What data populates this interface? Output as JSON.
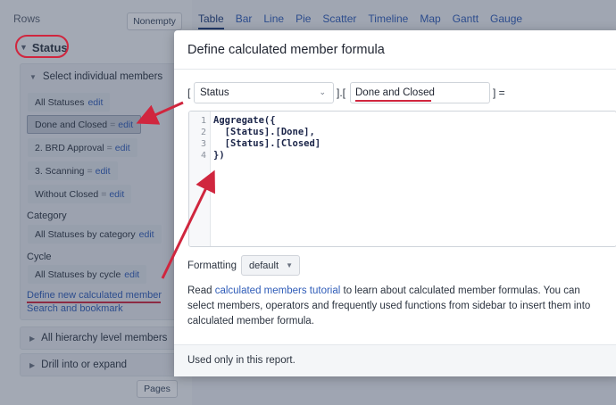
{
  "rows_panel": {
    "title": "Rows",
    "nonempty_label": "Nonempty",
    "dimension_label": "Status",
    "select_members_label": "Select individual members",
    "members": [
      {
        "name": "All Statuses",
        "eq": "",
        "edit": "edit"
      },
      {
        "name": "Done and Closed",
        "eq": "=",
        "edit": "edit"
      },
      {
        "name": "2. BRD Approval",
        "eq": "=",
        "edit": "edit"
      },
      {
        "name": "3. Scanning",
        "eq": "=",
        "edit": "edit"
      },
      {
        "name": "Without Closed",
        "eq": "=",
        "edit": "edit"
      }
    ],
    "category_label": "Category",
    "category_member": {
      "name": "All Statuses by category",
      "edit": "edit"
    },
    "cycle_label": "Cycle",
    "cycle_member": {
      "name": "All Statuses by cycle",
      "edit": "edit"
    },
    "define_link": "Define new calculated member",
    "search_link": "Search and bookmark",
    "hierarchy_label": "All hierarchy level members",
    "drill_label": "Drill into or expand",
    "pages_label": "Pages"
  },
  "tabs": [
    "Table",
    "Bar",
    "Line",
    "Pie",
    "Scatter",
    "Timeline",
    "Map",
    "Gantt",
    "Gauge"
  ],
  "modal": {
    "title": "Define calculated member formula",
    "bracket_open": "[",
    "bracket_mid": "].[",
    "bracket_close": "] =",
    "dimension_select": "Status",
    "member_name": "Done and Closed",
    "code_lines": [
      "Aggregate({",
      "  [Status].[Done],",
      "  [Status].[Closed]",
      "})"
    ],
    "line_numbers": [
      "1",
      "2",
      "3",
      "4"
    ],
    "formatting_label": "Formatting",
    "formatting_value": "default",
    "help_read": "Read ",
    "help_link": "calculated members tutorial",
    "help_rest": " to learn about calculated member formulas. You can select members, operators and frequently used functions from sidebar to insert them into calculated member formula.",
    "footer_text": "Used only in this report."
  },
  "colors": {
    "annotation": "#d0263e",
    "link": "#2f5cb8"
  }
}
